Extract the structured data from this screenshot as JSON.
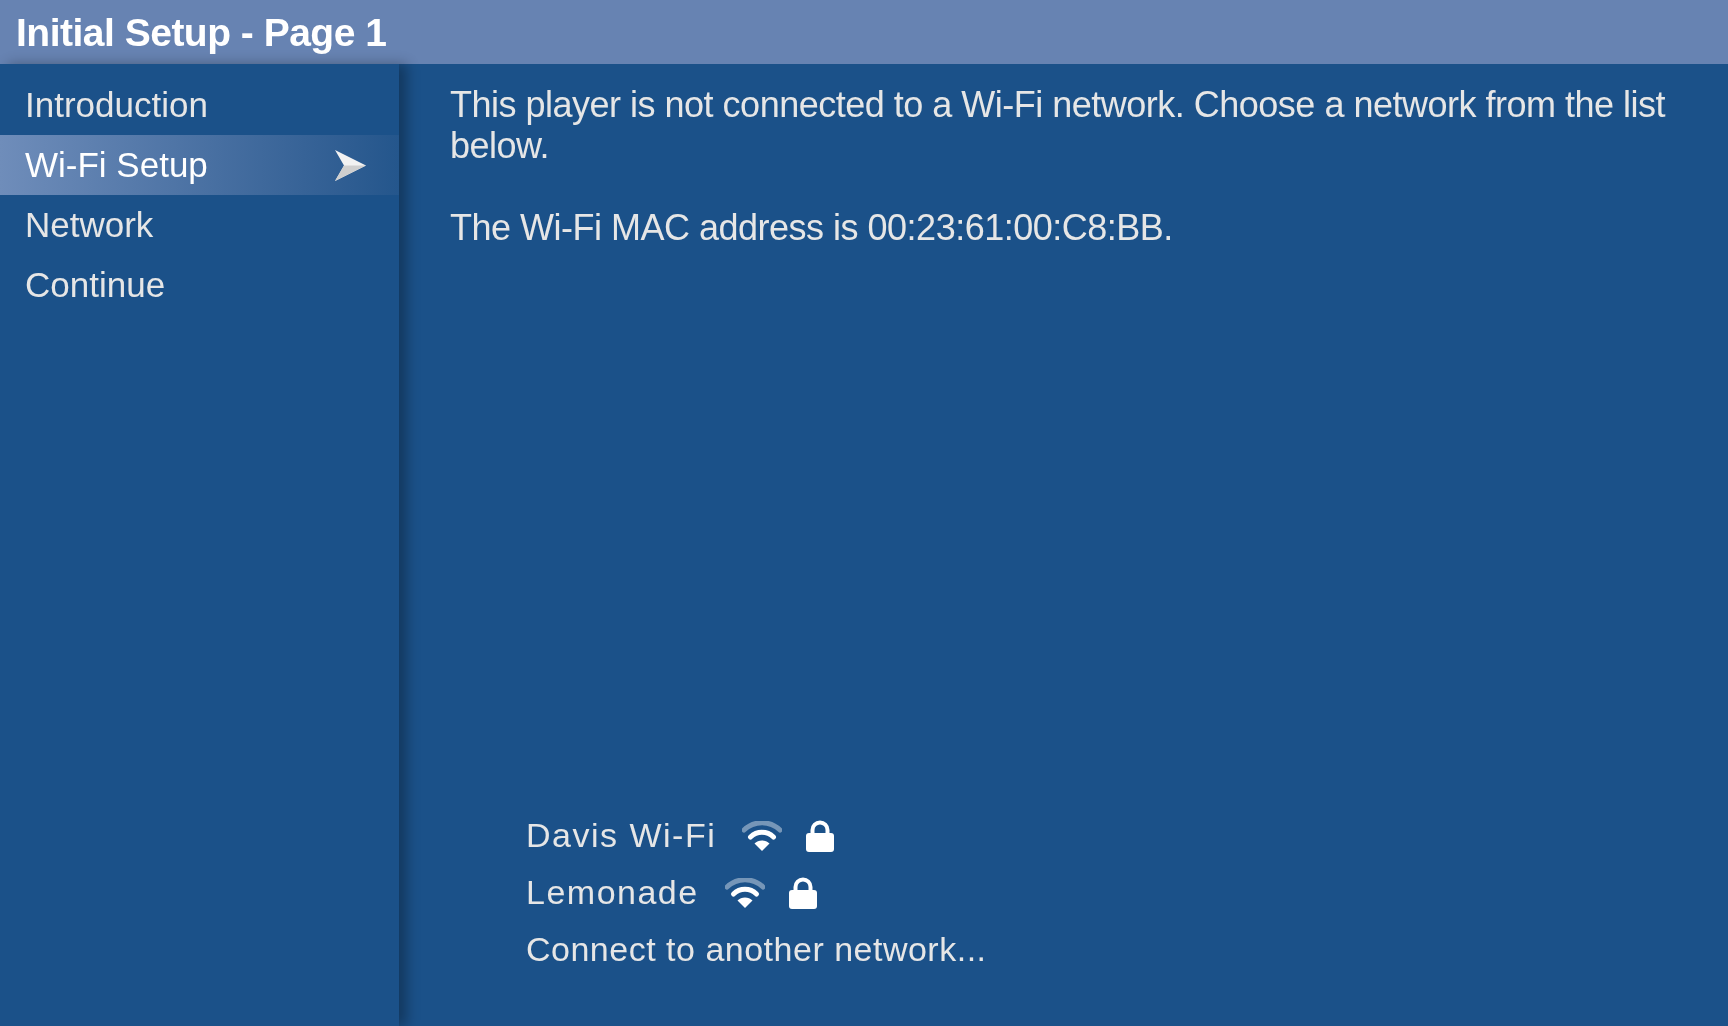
{
  "window": {
    "title": "Initial Setup - Page 1"
  },
  "sidebar": {
    "items": [
      {
        "label": "Introduction",
        "selected": false
      },
      {
        "label": "Wi-Fi Setup",
        "selected": true
      },
      {
        "label": "Network",
        "selected": false
      },
      {
        "label": "Continue",
        "selected": false
      }
    ]
  },
  "main": {
    "paragraphs": [
      "This player is not connected to a Wi-Fi network. Choose a network from the list below.",
      "The Wi-Fi MAC address is 00:23:61:00:C8:BB."
    ],
    "networks": [
      {
        "name": "Davis Wi-Fi",
        "secured": true
      },
      {
        "name": "Lemonade",
        "secured": true
      }
    ],
    "other_network": "Connect to another network..."
  }
}
